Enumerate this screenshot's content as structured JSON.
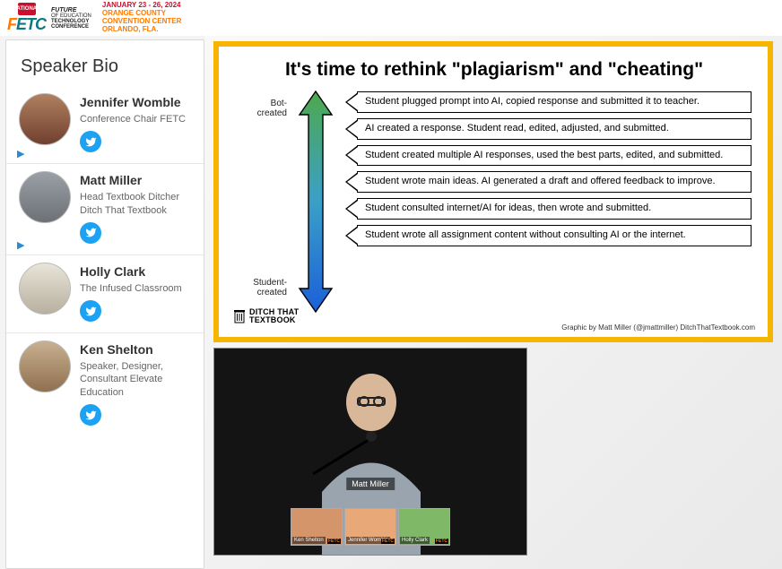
{
  "header": {
    "badge": "NATIONAL",
    "brand_f": "F",
    "brand_etc": "ETC",
    "brand_sub1": "FUTURE",
    "brand_sub2": "of EDUCATION",
    "brand_sub3": "TECHNOLOGY",
    "brand_sub4": "CONFERENCE",
    "date1": "JANUARY 23 - 26, 2024",
    "date2": "ORANGE COUNTY",
    "date3": "CONVENTION CENTER",
    "date4": "ORLANDO, FLA."
  },
  "sidebar": {
    "title": "Speaker Bio",
    "speakers": [
      {
        "name": "Jennifer Womble",
        "title": "Conference Chair\nFETC",
        "avatar_bg": "linear-gradient(#b08060,#704030)"
      },
      {
        "name": "Matt Miller",
        "title": "Head Textbook Ditcher\nDitch That Textbook",
        "avatar_bg": "linear-gradient(#9aa0a6,#6d7176)"
      },
      {
        "name": "Holly Clark",
        "title": "The Infused Classroom",
        "avatar_bg": "linear-gradient(#e8e4d8,#b8b0a0)"
      },
      {
        "name": "Ken Shelton",
        "title": "Speaker, Designer, Consultant\nElevate Education",
        "avatar_bg": "linear-gradient(#c8b090,#907050)"
      }
    ]
  },
  "slide": {
    "title": "It's time to rethink \"plagiarism\" and \"cheating\"",
    "axis_top": "Bot-\ncreated",
    "axis_bottom": "Student-\ncreated",
    "items": [
      "Student plugged prompt into AI, copied response and submitted it to teacher.",
      "AI created a response. Student read, edited, adjusted, and submitted.",
      "Student created multiple AI responses, used the best parts, edited, and submitted.",
      "Student wrote main ideas. AI generated a draft and offered feedback to improve.",
      "Student consulted internet/AI for ideas, then wrote and submitted.",
      "Student wrote all assignment content without consulting AI or the internet."
    ],
    "credit": "Graphic by Matt Miller (@jmattmiller) DitchThatTextbook.com",
    "logo_text": "DITCH THAT\nTEXTBOOK"
  },
  "video": {
    "main_label": "Matt Miller",
    "thumbs": [
      {
        "label": "Ken Shelton",
        "bg": "#d4956a"
      },
      {
        "label": "Jennifer Womble",
        "bg": "#e8a878"
      },
      {
        "label": "Holly Clark",
        "bg": "#7fb867"
      }
    ],
    "thumb_logo": "FETC"
  },
  "chart_data": {
    "type": "table",
    "title": "It's time to rethink \"plagiarism\" and \"cheating\"",
    "axis": {
      "top": "Bot-created",
      "bottom": "Student-created"
    },
    "rows": [
      {
        "rank": 1,
        "end": "Bot-created",
        "description": "Student plugged prompt into AI, copied response and submitted it to teacher."
      },
      {
        "rank": 2,
        "end": "",
        "description": "AI created a response. Student read, edited, adjusted, and submitted."
      },
      {
        "rank": 3,
        "end": "",
        "description": "Student created multiple AI responses, used the best parts, edited, and submitted."
      },
      {
        "rank": 4,
        "end": "",
        "description": "Student wrote main ideas. AI generated a draft and offered feedback to improve."
      },
      {
        "rank": 5,
        "end": "",
        "description": "Student consulted internet/AI for ideas, then wrote and submitted."
      },
      {
        "rank": 6,
        "end": "Student-created",
        "description": "Student wrote all assignment content without consulting AI or the internet."
      }
    ],
    "source": "Graphic by Matt Miller (@jmattmiller) DitchThatTextbook.com"
  }
}
